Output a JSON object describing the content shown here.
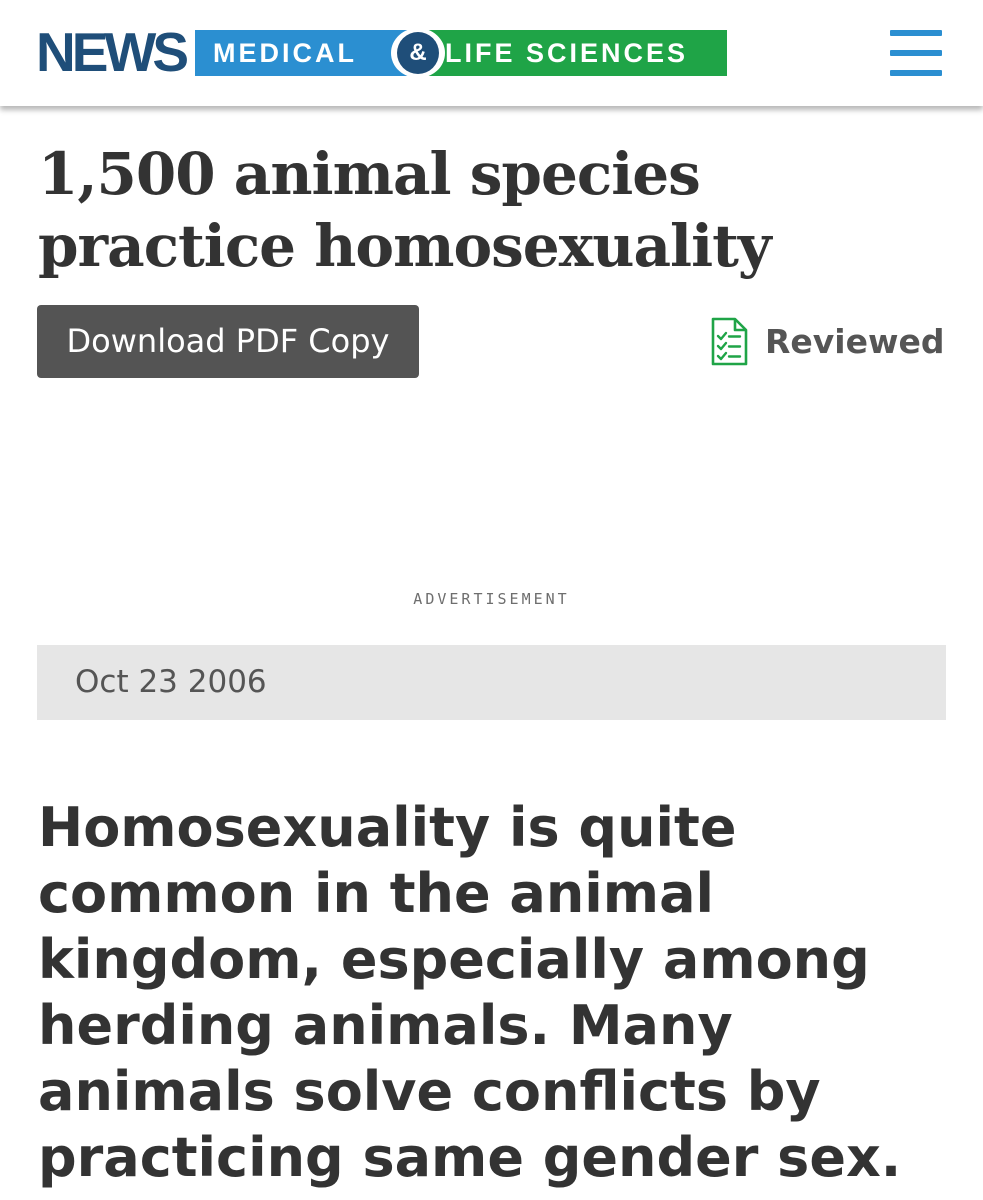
{
  "header": {
    "logo": {
      "news": "NEWS",
      "medical": "MEDICAL",
      "ampersand": "&",
      "life_sciences": "LIFE SCIENCES"
    },
    "menu_icon": "hamburger-menu-icon",
    "colors": {
      "navy": "#1f4e79",
      "blue": "#2b8fd1",
      "green": "#1fa447"
    }
  },
  "article": {
    "title": "1,500 animal species practice homosexuality",
    "download_button": "Download PDF Copy",
    "reviewed": {
      "icon": "checklist-icon",
      "label": "Reviewed",
      "color": "#1fa447"
    },
    "advertisement_label": "ADVERTISEMENT",
    "date": "Oct 23 2006",
    "lede": "Homosexuality is quite common in the animal kingdom, especially among herding animals. Many animals solve conflicts by practicing same gender sex."
  }
}
